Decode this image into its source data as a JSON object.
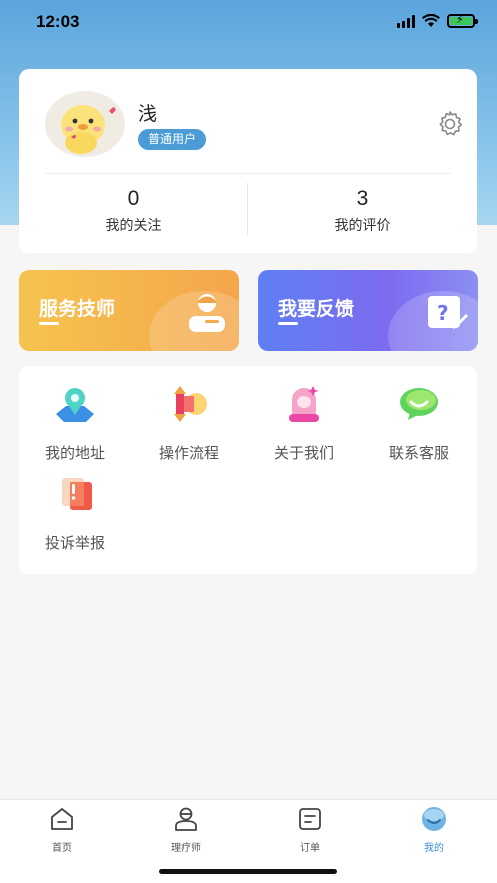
{
  "status_bar": {
    "time": "12:03"
  },
  "profile": {
    "username": "浅",
    "role": "普通用户",
    "stats": [
      {
        "value": "0",
        "label": "我的关注"
      },
      {
        "value": "3",
        "label": "我的评价"
      }
    ]
  },
  "banners": {
    "tech": {
      "title": "服务技师",
      "icon": "technician-icon"
    },
    "feedback": {
      "title": "我要反馈",
      "icon": "feedback-icon"
    }
  },
  "menu": {
    "items": [
      {
        "label": "我的地址",
        "icon": "location-map-icon"
      },
      {
        "label": "操作流程",
        "icon": "process-icon"
      },
      {
        "label": "关于我们",
        "icon": "about-us-icon"
      },
      {
        "label": "联系客服",
        "icon": "customer-service-chat-icon"
      },
      {
        "label": "投诉举报",
        "icon": "complaint-report-icon"
      }
    ]
  },
  "tabbar": {
    "tabs": [
      {
        "label": "首页",
        "icon": "home-icon"
      },
      {
        "label": "理疗师",
        "icon": "therapist-icon"
      },
      {
        "label": "订单",
        "icon": "order-icon"
      },
      {
        "label": "我的",
        "icon": "profile-icon",
        "active": true
      }
    ]
  },
  "colors": {
    "accent": "#4a9bd6",
    "banner_tech": "#f6c34f",
    "banner_feedback": "#6a7cf1"
  }
}
